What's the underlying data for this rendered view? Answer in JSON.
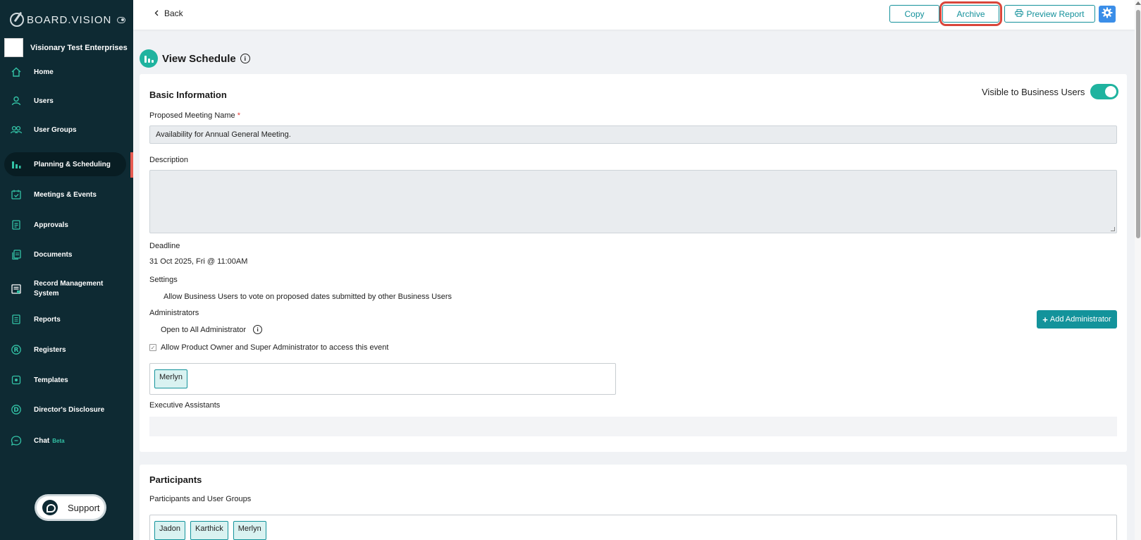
{
  "app": {
    "brand": "BOARD.VISION",
    "org_name": "Visionary Test Enterprises"
  },
  "sidebar": {
    "items": [
      {
        "label": "Home",
        "icon": "home-icon"
      },
      {
        "label": "Users",
        "icon": "user-icon"
      },
      {
        "label": "User Groups",
        "icon": "users-icon"
      },
      {
        "label": "Planning & Scheduling",
        "icon": "bar-chart-icon",
        "active": true
      },
      {
        "label": "Meetings & Events",
        "icon": "calendar-icon"
      },
      {
        "label": "Approvals",
        "icon": "approval-icon"
      },
      {
        "label": "Documents",
        "icon": "documents-icon"
      },
      {
        "label": "Record Management System",
        "icon": "record-icon"
      },
      {
        "label": "Reports",
        "icon": "report-icon"
      },
      {
        "label": "Registers",
        "icon": "registered-icon"
      },
      {
        "label": "Templates",
        "icon": "template-icon"
      },
      {
        "label": "Director's Disclosure",
        "icon": "disclosure-icon"
      },
      {
        "label": "Chat",
        "icon": "chat-icon",
        "badge": "Beta"
      }
    ],
    "support_label": "Support"
  },
  "toolbar": {
    "back_label": "Back",
    "copy_label": "Copy",
    "archive_label": "Archive",
    "preview_label": "Preview Report"
  },
  "page": {
    "title": "View Schedule"
  },
  "basic": {
    "title": "Basic Information",
    "visible_label": "Visible to Business Users",
    "visible_on": true,
    "meeting_name_label": "Proposed Meeting Name",
    "required_mark": "*",
    "meeting_name_value": "Availability for Annual General Meeting.",
    "description_label": "Description",
    "description_value": "",
    "deadline_label": "Deadline",
    "deadline_value": "31 Oct 2025, Fri @ 11:00AM",
    "settings_label": "Settings",
    "settings_value": "Allow Business Users to vote on proposed dates submitted by other Business Users",
    "administrators_label": "Administrators",
    "add_admin_label": "Add Administrator",
    "open_to_all_label": "Open to All Administrator",
    "allow_owner_label": "Allow Product Owner and Super Administrator to access this event",
    "admins": [
      "Merlyn"
    ],
    "ea_label": "Executive Assistants"
  },
  "participants": {
    "title": "Participants",
    "label": "Participants and User Groups",
    "items": [
      "Jadon",
      "Karthick",
      "Merlyn"
    ]
  },
  "colors": {
    "sidebar_bg": "#0e2a33",
    "accent": "#1fb39f",
    "button_teal": "#13939b",
    "highlight": "#d9463b"
  }
}
